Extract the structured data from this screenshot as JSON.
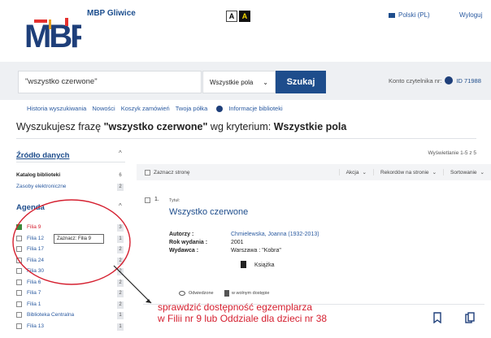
{
  "header": {
    "library_name": "MBP Gliwice",
    "logo_text": "MBP",
    "contrast_a": "A",
    "contrast_b": "A",
    "language": "Polski (PL)",
    "logout": "Wyloguj"
  },
  "search": {
    "query": "\"wszystko czerwone\"",
    "criteria": "Wszystkie pola",
    "button": "Szukaj",
    "account_label": "Konto czytelnika nr:",
    "account_id": "ID 71988"
  },
  "nav": {
    "items": [
      "Historia wyszukiwania",
      "Nowości",
      "Koszyk zamówień",
      "Twoja półka",
      "Informacje biblioteki"
    ]
  },
  "headline": {
    "prefix": "Wyszukujesz frazę ",
    "phrase": "\"wszystko czerwone\"",
    "mid": " wg kryterium: ",
    "criterion": "Wszystkie pola"
  },
  "sidebar": {
    "source_title": "Źródło danych",
    "source_items": [
      {
        "label": "Katalog biblioteki",
        "count": "6"
      },
      {
        "label": "Zasoby elektroniczne",
        "count": "2"
      }
    ],
    "agenda_title": "Agenda",
    "tooltip": "Zaznacz: Filia 9",
    "agenda_items": [
      {
        "label": "Filia 9",
        "count": "3",
        "checked": true
      },
      {
        "label": "Filia 12",
        "count": "1",
        "checked": false
      },
      {
        "label": "Filia 17",
        "count": "2",
        "checked": false
      },
      {
        "label": "Filia 24",
        "count": "2",
        "checked": false
      },
      {
        "label": "Filia 30",
        "count": "2",
        "checked": false
      },
      {
        "label": "Filia 6",
        "count": "2",
        "checked": false
      },
      {
        "label": "Filia 7",
        "count": "2",
        "checked": false
      },
      {
        "label": "Filia 1",
        "count": "2",
        "checked": false
      },
      {
        "label": "Biblioteka Centralna",
        "count": "1",
        "checked": false
      },
      {
        "label": "Filia 13",
        "count": "1",
        "checked": false
      }
    ]
  },
  "results": {
    "showing": "Wyświetlanie 1-5 z 5",
    "select_page": "Zaznacz stronę",
    "action": "Akcja",
    "per_page": "Rekordów na stronie",
    "sort": "Sortowanie",
    "item": {
      "number": "1.",
      "title_label": "Tytuł:",
      "title": "Wszystko czerwone",
      "authors_label": "Autorzy :",
      "authors": "Chmielewska, Joanna (1932-2013)",
      "year_label": "Rok wydania :",
      "year": "2001",
      "publisher_label": "Wydawca :",
      "publisher": "Warszawa : \"Kobra\"",
      "format": "Książka",
      "visited": "Odwiedzone",
      "available": "w wolnym dostępie"
    }
  },
  "annotation": {
    "line1": "sprawdzić dostępność egzemplarza",
    "line2": "w Filii nr 9 lub Oddziale dla dzieci nr 38"
  }
}
